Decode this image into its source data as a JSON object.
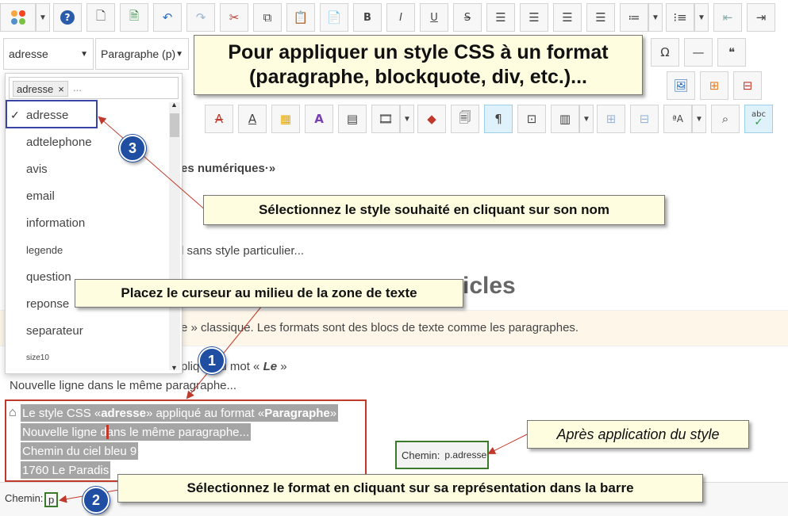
{
  "toolbar": {
    "row1_icons": [
      "joomla-icon",
      "help-icon",
      "new-document-icon",
      "insert-file-icon",
      "undo-icon",
      "redo-icon",
      "cut-icon",
      "copy-icon",
      "paste-icon",
      "paste-text-icon",
      "bold-icon",
      "italic-icon",
      "underline-icon",
      "strikethrough-icon",
      "align-justify-icon",
      "align-left-icon",
      "align-center-icon",
      "align-right-icon",
      "numbered-list-icon",
      "bullet-list-icon",
      "outdent-icon",
      "indent-icon"
    ],
    "bold": "B",
    "italic": "I",
    "underline": "U",
    "strike": "S",
    "style_select_value": "adresse",
    "format_select_value": "Paragraphe (p)",
    "omega": "Ω",
    "quote": "❝",
    "pilcrow": "¶",
    "abc": "abc"
  },
  "dropdown": {
    "tag_label": "adresse",
    "tag_close": "×",
    "search_placeholder": "...",
    "checkmark": "✓",
    "items": [
      "adresse",
      "adtelephone",
      "avis",
      "email",
      "information",
      "legende",
      "question",
      "reponse",
      "separateur",
      "size10"
    ]
  },
  "editor": {
    "line1": "es numériques·»",
    "line2": "l sans style particulier...",
    "heading": "icles",
    "band_text": "e » classique. Les formats sont des blocs de texte comme les paragraphes.",
    "line3_pre": "pliq",
    "line3_mid": "u mot « ",
    "line3_em": "Le",
    "line3_post": " »",
    "line4": "Nouvelle ligne dans le même paragraphe...",
    "selected": {
      "l1_a": "Le style CSS « ",
      "l1_b": "adresse",
      "l1_c": " » appliqué au format « ",
      "l1_d": "Paragraphe",
      "l1_e": " »",
      "l2": "Nouvelle ligne dans le même paragraphe...",
      "l3": "Chemin du ciel bleu 9",
      "l4": "1760 Le Paradis"
    }
  },
  "statusbar": {
    "path_label": "Chemin:",
    "path_value": "p"
  },
  "after": {
    "path_label": "Chemin:",
    "path_value": "p.adresse"
  },
  "callouts": {
    "top": "Pour appliquer un style CSS à un format (paragraphe, blockquote, div, etc.)...",
    "select_style": "Sélectionnez le style souhaité en cliquant sur son nom",
    "place_cursor": "Placez le curseur au milieu de la zone de texte",
    "select_format": "Sélectionnez le format en cliquant sur sa représentation dans la barre",
    "after": "Après application du style",
    "n1": "1",
    "n2": "2",
    "n3": "3"
  }
}
